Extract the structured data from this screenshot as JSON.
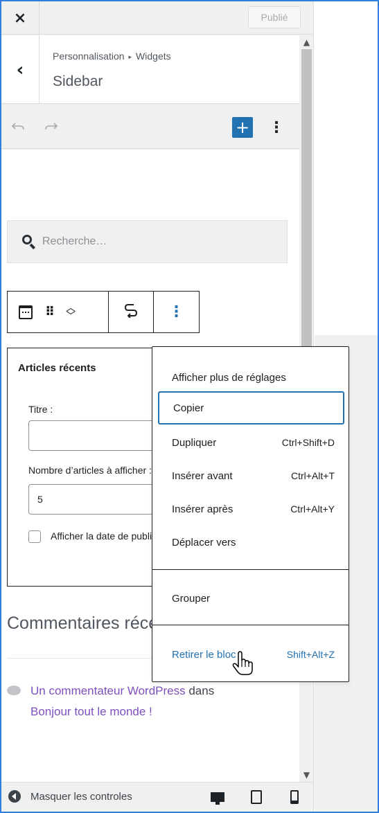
{
  "topbar": {
    "close_label": "×",
    "publish_label": "Publié"
  },
  "header": {
    "back_label": "‹",
    "breadcrumb_parent": "Personnalisation",
    "breadcrumb_separator": "▸",
    "breadcrumb_current": "Widgets",
    "title": "Sidebar"
  },
  "toolbar": {
    "undo_icon": "undo-icon",
    "redo_icon": "redo-icon",
    "add_label": "+",
    "more_label": "⋮"
  },
  "search": {
    "placeholder": "Recherche…"
  },
  "block_toolbar": {
    "icons": [
      "calendar-icon",
      "drag-handle-icon",
      "move-up-down-icon",
      "transform-icon",
      "options-icon"
    ]
  },
  "widget": {
    "title": "Articles récents",
    "title_field_label": "Titre :",
    "title_field_value": "",
    "count_label": "Nombre d’articles à afficher :",
    "count_value": "5",
    "show_date_label": "Afficher la date de publication ?",
    "show_date_checked": false
  },
  "comments": {
    "title": "Commentaires récents",
    "author": "Un commentateur WordPress",
    "connector": " dans",
    "post": "Bonjour tout le monde !"
  },
  "menu": {
    "items": [
      {
        "label": "Afficher plus de réglages",
        "shortcut": ""
      },
      {
        "label": "Copier",
        "shortcut": ""
      },
      {
        "label": "Dupliquer",
        "shortcut": "Ctrl+Shift+D"
      },
      {
        "label": "Insérer avant",
        "shortcut": "Ctrl+Alt+T"
      },
      {
        "label": "Insérer après",
        "shortcut": "Ctrl+Alt+Y"
      },
      {
        "label": "Déplacer vers",
        "shortcut": ""
      }
    ],
    "group_label": "Grouper",
    "remove_label": "Retirer le bloc",
    "remove_shortcut": "Shift+Alt+Z"
  },
  "bottombar": {
    "hide_controls_label": "Masquer les controles",
    "devices": [
      "desktop-icon",
      "tablet-icon",
      "mobile-icon"
    ]
  },
  "colors": {
    "accent": "#2271b1",
    "link": "#7e4fbd",
    "panel_bg": "#f0f0f1",
    "frame": "#2f7fe0"
  }
}
